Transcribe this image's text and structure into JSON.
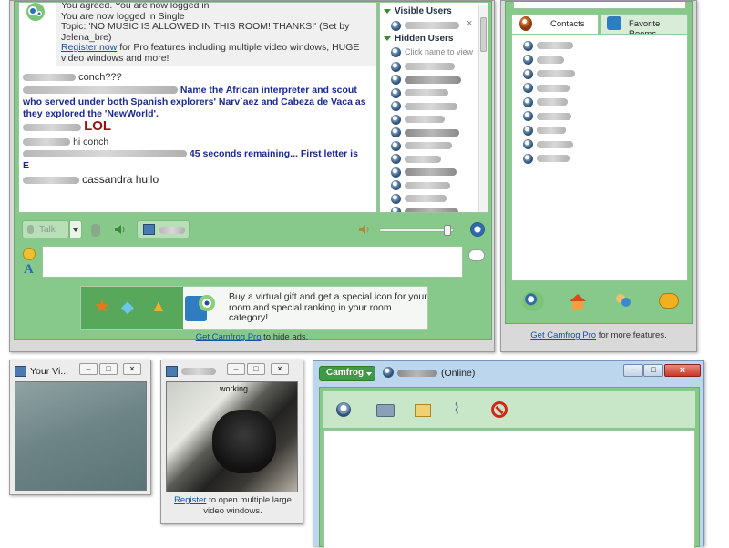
{
  "chat": {
    "system_lines": [
      "You agreed. You are now logged in",
      "You are now logged in Single",
      "Topic: 'NO MUSIC IS ALLOWED IN THIS ROOM! THANKS!' (Set by Jelena_bre)"
    ],
    "register_link": "Register now",
    "register_rest": " for Pro features including multiple video windows, HUGE video windows and more!",
    "msg1": "conch???",
    "msg2": "Name the African interpreter and scout who served under both Spanish explorers' Narv`aez and Cabeza de Vaca as they explored the 'NewWorld'.",
    "msg3": "LOL",
    "msg4": "hi conch",
    "msg5a": "45 seconds remaining... First letter is",
    "msg5b": "E",
    "msg6": "cassandra hullo"
  },
  "users": {
    "visible_header": "Visible Users",
    "hidden_header": "Hidden Users",
    "hint": "Click name to view",
    "close": "×"
  },
  "toolbar": {
    "talk_label": "Talk"
  },
  "ad": {
    "line": "Buy a virtual gift and get a special icon for your room and special ranking in your room category!",
    "get_pro": "Get Camfrog Pro",
    "hide_ads": " to hide ads."
  },
  "contacts": {
    "tab_contacts": "Contacts",
    "tab_rooms": "Favorite Rooms",
    "get_pro": "Get Camfrog Pro",
    "more_features": " for more features."
  },
  "video1": {
    "title": "Your Vi..."
  },
  "video2": {
    "overlay": "working",
    "register": "Register",
    "register_rest": " to open multiple large video windows."
  },
  "im": {
    "menu": "Camfrog",
    "status": "(Online)"
  },
  "colors": {
    "accent_green": "#86c98a",
    "navy_text": "#1c2a8c",
    "lol_red": "#9a1010",
    "link_blue": "#1a4fa8",
    "close_red": "#c8362a"
  }
}
